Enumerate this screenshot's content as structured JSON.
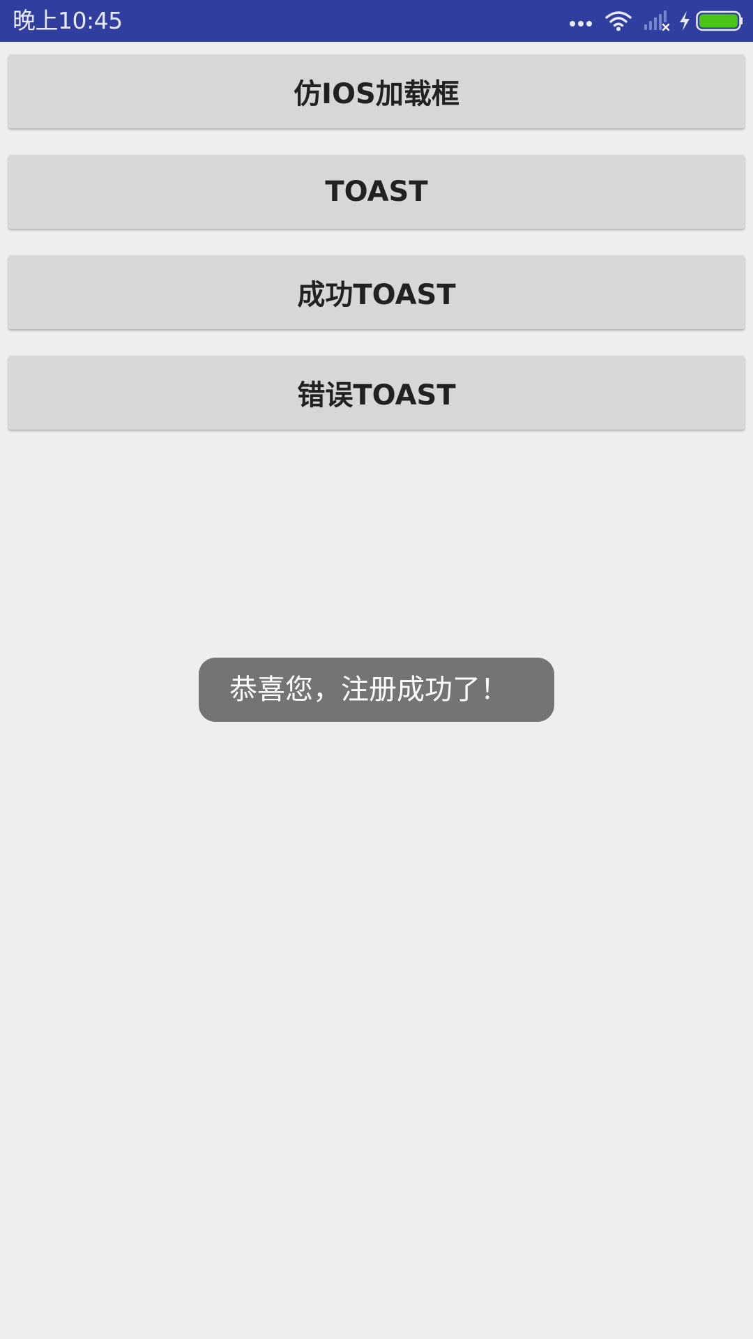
{
  "status_bar": {
    "time": "晚上10:45",
    "background": "#303f9f",
    "icons": [
      "more-dots-icon",
      "wifi-icon",
      "signal-no-sim-icon",
      "charging-bolt-icon",
      "battery-icon"
    ],
    "battery_color": "#4cc417",
    "battery_level": 1.0
  },
  "buttons": [
    {
      "label": "仿IOS加载框"
    },
    {
      "label": "TOAST"
    },
    {
      "label": "成功TOAST"
    },
    {
      "label": "错误TOAST"
    }
  ],
  "toast": {
    "message": "恭喜您，注册成功了！"
  },
  "colors": {
    "page_background": "#eeeeee",
    "button_background": "#d6d7d7",
    "toast_background": "#747474"
  }
}
